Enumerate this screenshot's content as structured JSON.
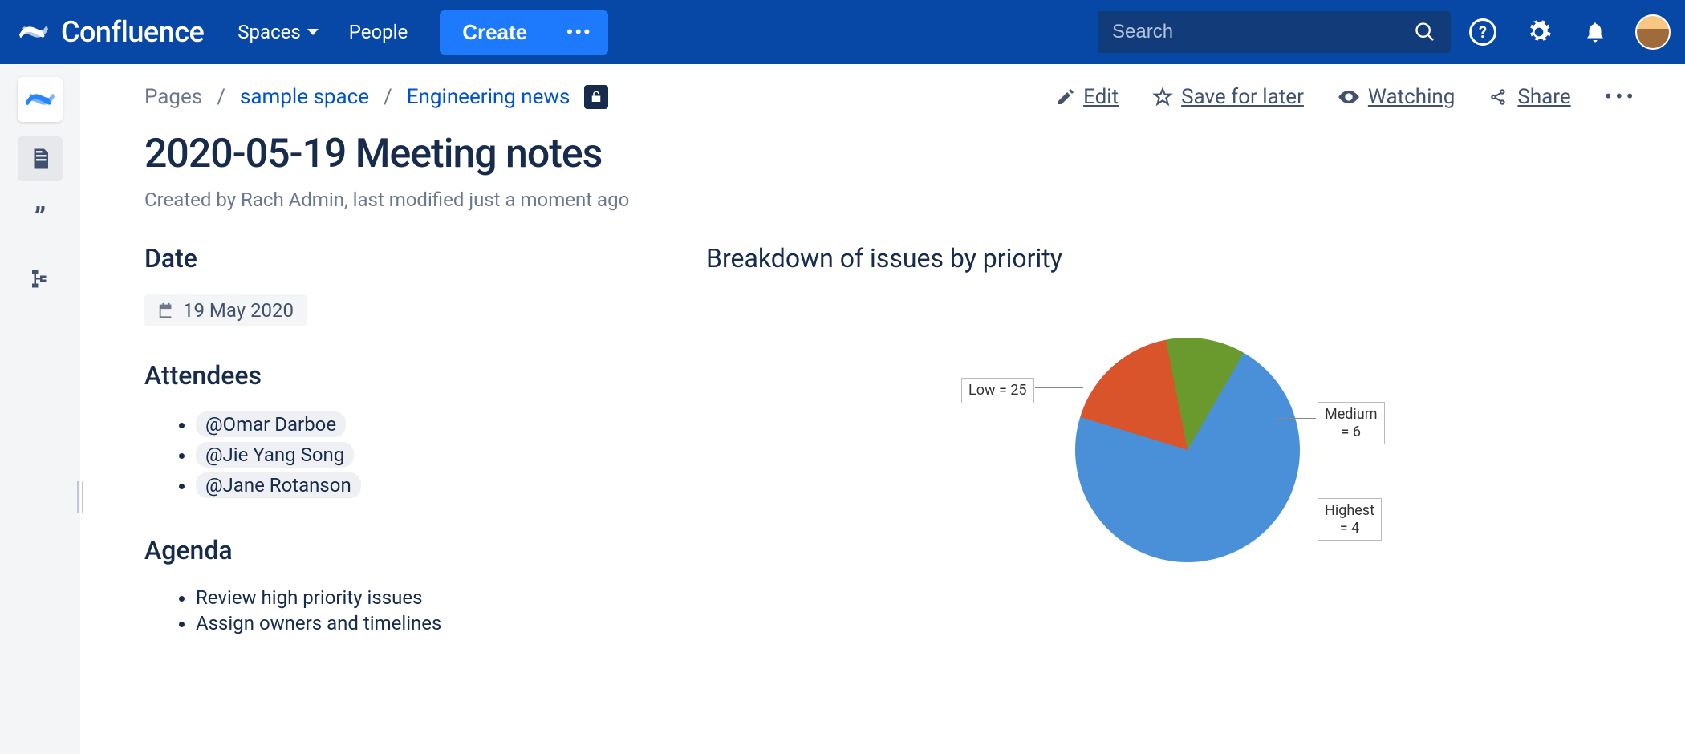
{
  "nav": {
    "product": "Confluence",
    "spaces": "Spaces",
    "people": "People",
    "create": "Create",
    "search_placeholder": "Search"
  },
  "breadcrumb": {
    "root": "Pages",
    "space": "sample space",
    "parent": "Engineering news"
  },
  "actions": {
    "edit": "Edit",
    "save": "Save for later",
    "watch": "Watching",
    "share": "Share"
  },
  "page": {
    "title": "2020-05-19 Meeting notes",
    "byline": "Created by Rach Admin, last modified just a moment ago"
  },
  "sections": {
    "date": "Date",
    "date_value": "19 May 2020",
    "attendees": "Attendees",
    "people": [
      "@Omar Darboe",
      "@Jie Yang Song",
      "@Jane Rotanson"
    ],
    "agenda": "Agenda",
    "agenda_items": [
      "Review high priority issues",
      "Assign owners and timelines"
    ]
  },
  "chart_data": {
    "type": "pie",
    "title": "Breakdown of issues by priority",
    "series": [
      {
        "name": "Low",
        "value": 25,
        "color": "#4a90d9",
        "label": "Low = 25"
      },
      {
        "name": "Medium",
        "value": 6,
        "color": "#d9542b",
        "label": "Medium\n= 6"
      },
      {
        "name": "Highest",
        "value": 4,
        "color": "#6a9a2d",
        "label": "Highest\n= 4"
      }
    ]
  }
}
